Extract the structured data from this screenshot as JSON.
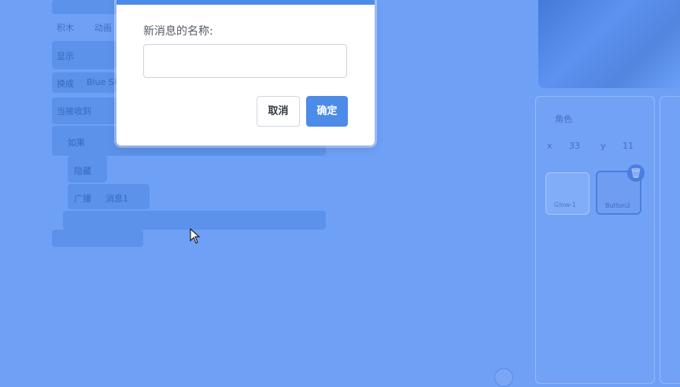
{
  "dialog": {
    "label": "新消息的名称:",
    "input_value": "",
    "input_placeholder": "",
    "cancel_label": "取消",
    "ok_label": "确定",
    "accent_color": "#4c8be8"
  },
  "background": {
    "blocks": {
      "tab_costumes": "积木",
      "tab_sounds": "动画",
      "say_label": "显示",
      "switch_label": "换成",
      "switch_value": "Blue Sk",
      "event_label": "当接收到",
      "if_label": "如果",
      "hide_label": "隐藏",
      "broadcast_label": "广播",
      "broadcast_value": "消息1"
    },
    "sprite_info": {
      "sprite_label": "角色",
      "x_label": "x",
      "x_value": "33",
      "y_label": "y",
      "y_value": "11"
    },
    "sprites": [
      {
        "name": "Glow-1"
      },
      {
        "name": "Button2"
      }
    ]
  },
  "colors": {
    "overlay": "#6ea0f6",
    "selected_sprite": "#4a7ee0"
  }
}
